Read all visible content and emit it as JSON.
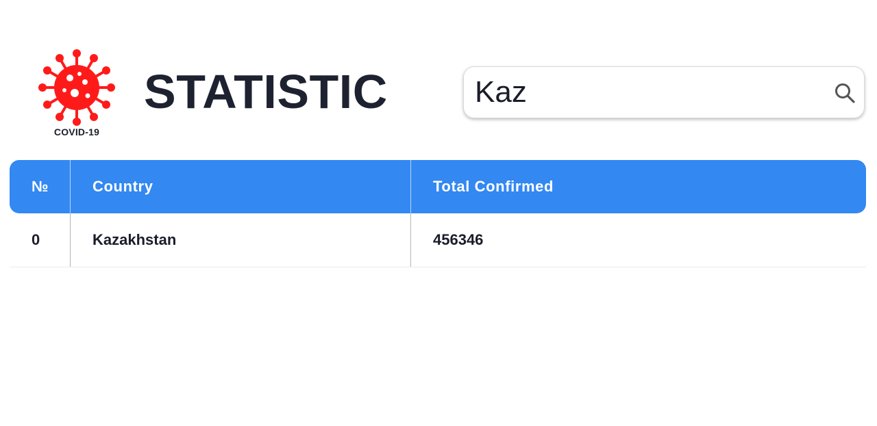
{
  "logo": {
    "caption": "COVID-19",
    "color": "#ff1a1a"
  },
  "title": "STATISTIC",
  "search": {
    "value": "Kaz",
    "icon": "search-icon"
  },
  "table": {
    "header_color": "#3388f2",
    "columns": [
      "№",
      "Country",
      "Total Confirmed"
    ],
    "rows": [
      {
        "index": "0",
        "country": "Kazakhstan",
        "total_confirmed": "456346"
      }
    ]
  }
}
